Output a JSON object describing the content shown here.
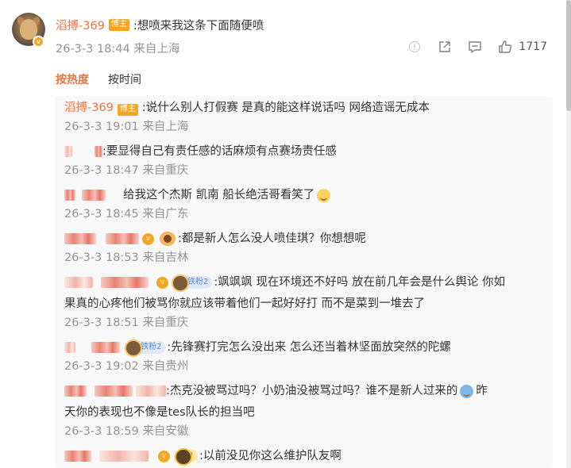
{
  "top_comment": {
    "username": "滔搏-369",
    "owner_tag": "博主",
    "text": ":想喷来我这条下面随便喷",
    "time": "26-3-3 18:44",
    "location": "来自上海",
    "like_count": "1717"
  },
  "sort": {
    "hot_label": "按热度",
    "time_label": "按时间"
  },
  "replies": [
    {
      "username": "滔搏-369",
      "owner_tag": "博主",
      "text": ":说什么别人打假赛  是真的能这样说话吗  网络造谣无成本",
      "time": "26-3-3 19:01",
      "location": "来自上海"
    },
    {
      "text": ":要显得自己有责任感的话麻烦有点赛场责任感",
      "time": "26-3-3 18:47",
      "location": "来自重庆"
    },
    {
      "text": "给我这个杰斯 凯南 船长绝活哥看笑了",
      "time": "26-3-3 18:45",
      "location": "来自广东"
    },
    {
      "text": ":都是新人怎么没人喷佳琪？你想想呢",
      "time": "26-3-3 18:53",
      "location": "来自吉林"
    },
    {
      "fan_label": "铁粉2",
      "text_line1": ":飒飒飒  现在环境还不好吗  放在前几年会是什么舆论  你如",
      "text_line2": "果真的心疼他们被骂你就应该带着他们一起好好打  而不是菜到一堆去了",
      "time": "26-3-3 18:51",
      "location": "来自重庆"
    },
    {
      "fan_label": "铁粉2",
      "text": ":先锋赛打完怎么没出来  怎么还当着林坚面放突然的陀螺",
      "time": "26-3-3 19:02",
      "location": "来自贵州"
    },
    {
      "text_line1": ":杰克没被骂过吗？小奶油没被骂过吗？谁不是新人过来的",
      "text_line1_end": "昨",
      "text_line2": "天你的表现也不像是tes队长的担当吧",
      "time": "26-3-3 18:59",
      "location": "来自安徽"
    },
    {
      "crown_label": "Ⅰ",
      "text": ":以前没见你这么维护队友啊"
    }
  ],
  "colors": {
    "accent": "#eb7340",
    "meta": "#939393",
    "panel": "#f8f8f8"
  },
  "icons": [
    "report-icon",
    "share-icon",
    "comment-icon",
    "like-icon"
  ]
}
